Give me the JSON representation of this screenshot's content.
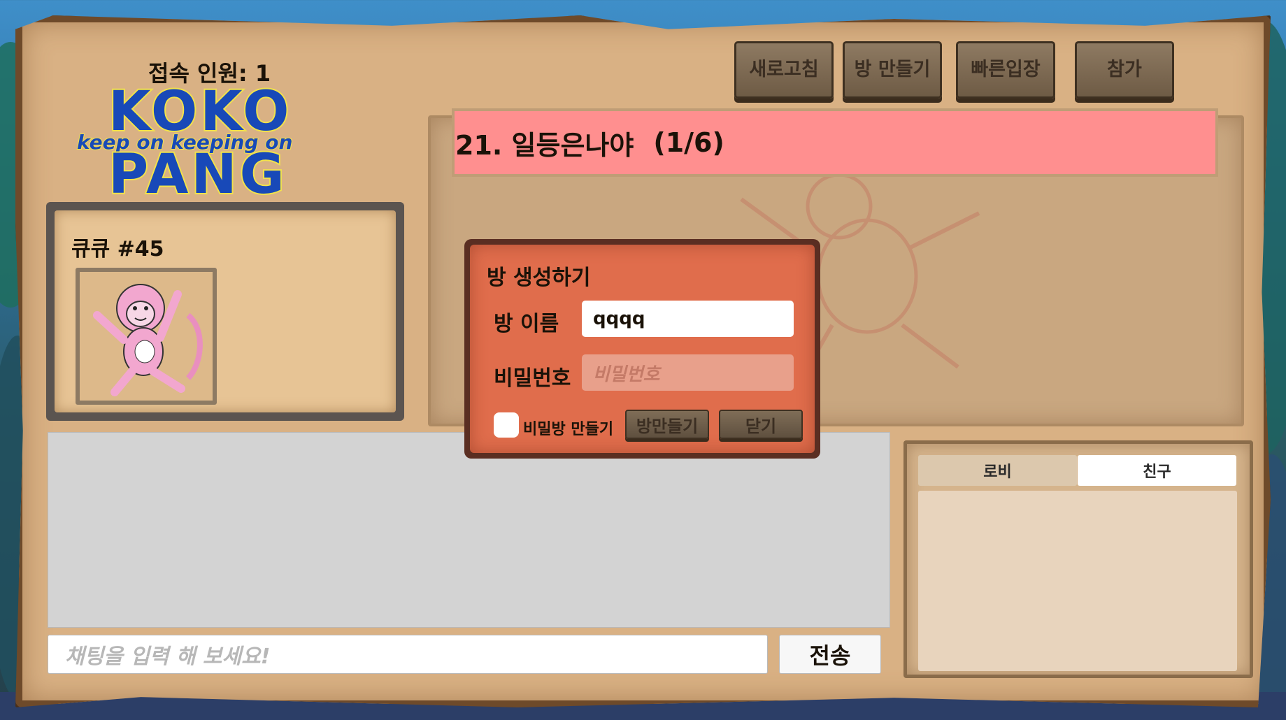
{
  "header": {
    "online_count_label": "접속 인원: 1",
    "logo": {
      "line1": "KOKO",
      "tagline": "keep on keeping on",
      "line2": "PANG"
    }
  },
  "toolbar": {
    "refresh_label": "새로고침",
    "create_room_label": "방 만들기",
    "quick_join_label": "빠른입장",
    "join_label": "참가"
  },
  "profile": {
    "name": "큐큐 #45"
  },
  "rooms": [
    {
      "title": "21. 일등은나야",
      "occupancy": "(1/6)"
    }
  ],
  "create_room_dialog": {
    "title": "방 생성하기",
    "room_name_label": "방 이름",
    "room_name_value": "qqqq",
    "password_label": "비밀번호",
    "password_placeholder": "비밀번호",
    "private_checkbox_label": "비밀방 만들기",
    "private_checked": false,
    "create_button_label": "방만들기",
    "close_button_label": "닫기"
  },
  "chat": {
    "input_placeholder": "채팅을 입력 해 보세요!",
    "send_label": "전송"
  },
  "side_panel": {
    "tabs": [
      {
        "label": "로비",
        "active": false
      },
      {
        "label": "친구",
        "active": true
      }
    ]
  },
  "colors": {
    "room_row": "#ff8f8f",
    "dialog": "#e06d4c",
    "logo_blue": "#1849b8",
    "logo_yellow": "#f1e24b"
  }
}
